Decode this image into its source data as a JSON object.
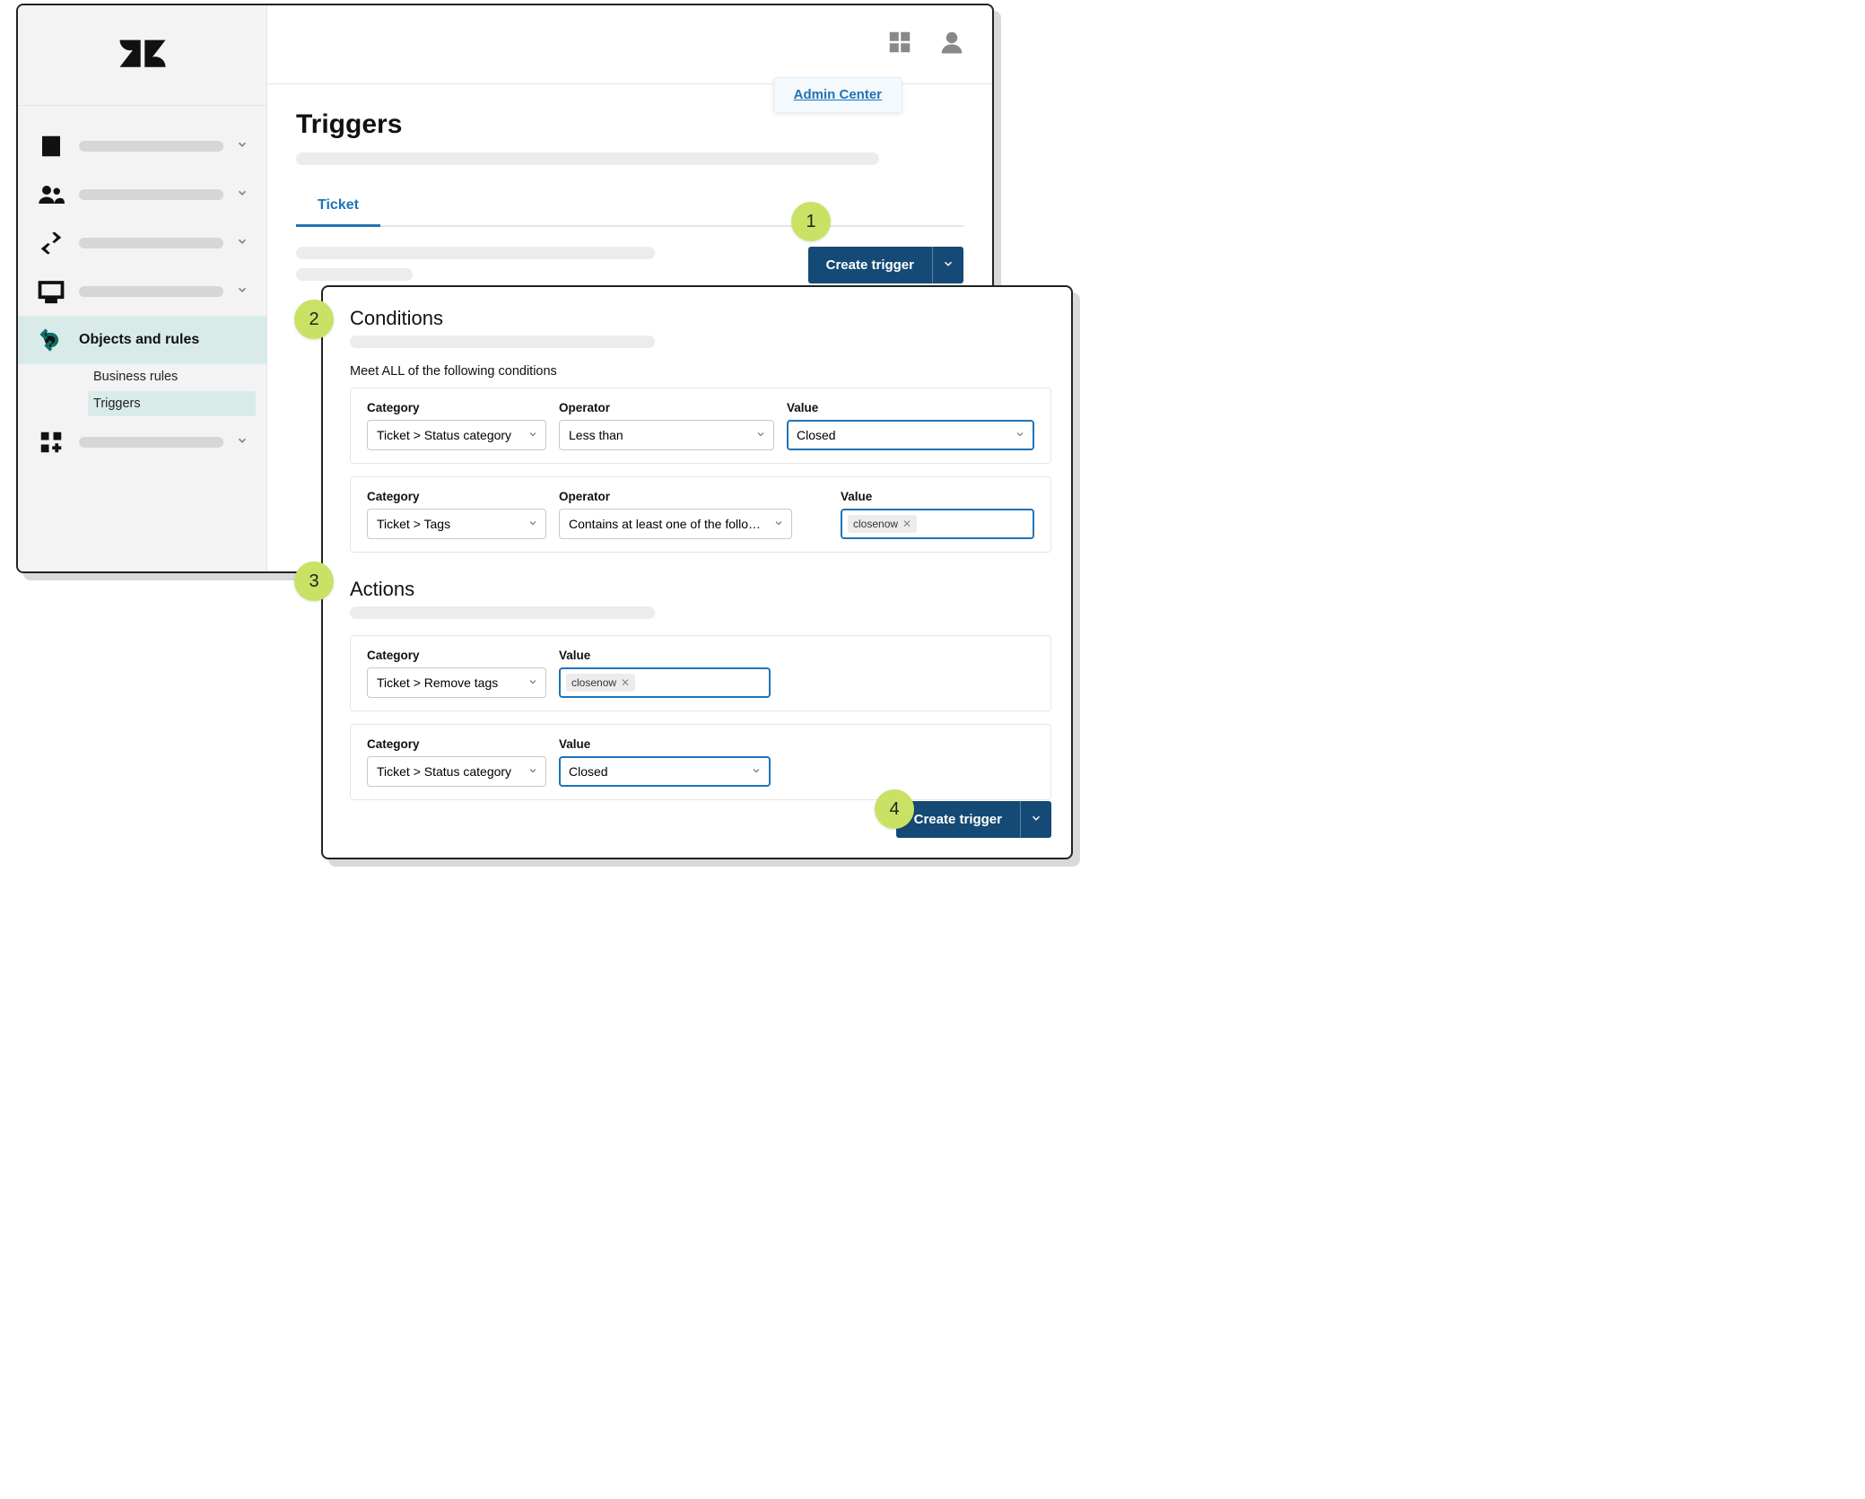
{
  "header": {
    "admin_center_label": "Admin Center"
  },
  "sidebar": {
    "items": [
      {
        "icon": "building"
      },
      {
        "icon": "people"
      },
      {
        "icon": "transfer"
      },
      {
        "icon": "monitor"
      },
      {
        "icon": "rules",
        "label": "Objects and rules",
        "active": true,
        "sub": [
          {
            "label": "Business rules"
          },
          {
            "label": "Triggers",
            "highlight": true
          }
        ]
      },
      {
        "icon": "apps"
      }
    ]
  },
  "page": {
    "title": "Triggers",
    "tab_label": "Ticket",
    "create_button": "Create trigger"
  },
  "steps": {
    "s1": "1",
    "s2": "2",
    "s3": "3",
    "s4": "4"
  },
  "panel": {
    "conditions": {
      "title": "Conditions",
      "meet_all": "Meet ALL of the following conditions",
      "labels": {
        "category": "Category",
        "operator": "Operator",
        "value": "Value"
      },
      "rows": [
        {
          "category": "Ticket > Status category",
          "operator": "Less than",
          "value": "Closed",
          "value_focus": true
        },
        {
          "category": "Ticket > Tags",
          "operator": "Contains at least one of the following",
          "tags": [
            "closenow"
          ]
        }
      ]
    },
    "actions": {
      "title": "Actions",
      "labels": {
        "category": "Category",
        "value": "Value"
      },
      "rows": [
        {
          "category": "Ticket > Remove tags",
          "tags": [
            "closenow"
          ]
        },
        {
          "category": "Ticket > Status category",
          "value": "Closed",
          "value_focus": true
        }
      ],
      "create_button": "Create trigger"
    }
  }
}
